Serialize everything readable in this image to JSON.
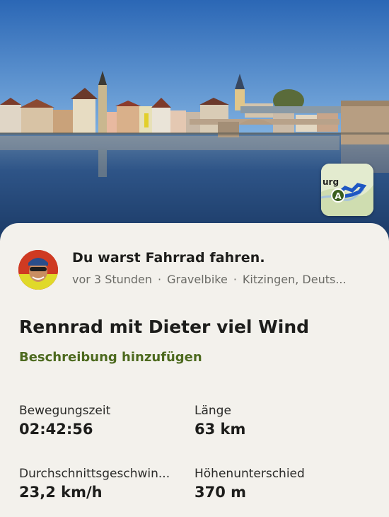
{
  "activity": {
    "headline": "Du warst Fahrrad fahren.",
    "time_ago": "vor 3 Stunden",
    "sport": "Gravelbike",
    "location": "Kitzingen, Deuts...",
    "title": "Rennrad mit Dieter viel Wind",
    "add_description_label": "Beschreibung hinzufügen"
  },
  "map_thumbnail": {
    "place_fragment": "urg",
    "start_marker": "A",
    "route_color": "#1f57c3"
  },
  "stats": [
    {
      "label": "Bewegungszeit",
      "value": "02:42:56"
    },
    {
      "label": "Länge",
      "value": "63 km"
    },
    {
      "label": "Durchschnittsgeschwin...",
      "value": "23,2 km/h"
    },
    {
      "label": "Höhenunterschied",
      "value": "370 m"
    }
  ],
  "colors": {
    "accent_green": "#4d6a1f",
    "sheet_background": "#f3f1ec"
  }
}
